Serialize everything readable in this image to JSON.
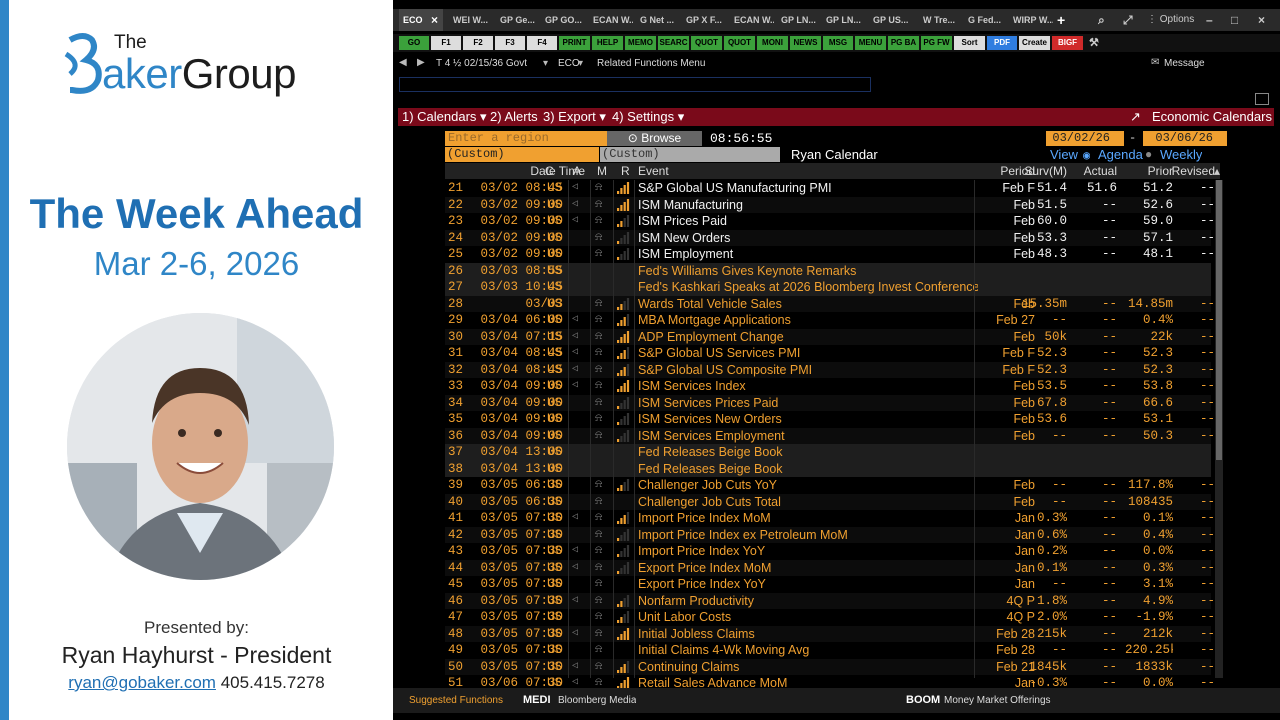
{
  "slide": {
    "logo_the": "The",
    "logo_brand_1": "aker",
    "logo_brand_2": "Group",
    "title": "The Week Ahead",
    "dates": "Mar 2-6, 2026",
    "presented_by": "Presented by:",
    "presenter": "Ryan Hayhurst - President",
    "email": "ryan@gobaker.com",
    "phone": "405.415.7278",
    "colors": {
      "brand_blue": "#2f86c7",
      "title_blue": "#1f6fb3"
    }
  },
  "terminal": {
    "tabs": [
      "ECO",
      "WEI W...",
      "GP Ge...",
      "GP GO...",
      "ECAN W...",
      "G Net ...",
      "GP X F...",
      "ECAN W...",
      "GP LN...",
      "GP LN...",
      "GP US...",
      "W Tre...",
      "G Fed...",
      "WIRP W..."
    ],
    "options_label": "Options",
    "fkeys": [
      "GO",
      "F1",
      "F2",
      "F3",
      "F4",
      "PRINT",
      "HELP",
      "MEMO",
      "SEARC",
      "QUOT",
      "QUOT",
      "MONI",
      "NEWS",
      "MSG",
      "MENU",
      "PG BA",
      "PG FW",
      "Sort",
      "PDF",
      "Create",
      "BIGF"
    ],
    "nav": {
      "security": "T 4 ½ 02/15/36 Govt",
      "function": "ECO",
      "related": "Related Functions Menu",
      "message": "Message"
    },
    "menu": {
      "calendars": "1) Calendars",
      "alerts": "2) Alerts",
      "export": "3) Export",
      "settings": "4) Settings",
      "title": "Economic Calendars"
    },
    "controls": {
      "region_placeholder": "Enter a region",
      "browse": "Browse",
      "time": "08:56:55",
      "date_from": "03/02/26",
      "date_to": "03/06/26",
      "custom1": "(Custom)",
      "custom2": "(Custom)",
      "calendar_name": "Ryan Calendar",
      "view_label": "View",
      "agenda": "Agenda",
      "weekly": "Weekly"
    },
    "columns": [
      "Date Time",
      "C",
      "A",
      "M",
      "R",
      "Event",
      "Period",
      "Surv(M)",
      "Actual",
      "Prior",
      "Revised"
    ],
    "rows": [
      {
        "n": "21",
        "dt": "03/02 08:45",
        "c": "US",
        "ev": "S&P Global US Manufacturing PMI",
        "per": "Feb F",
        "surv": "51.4",
        "act": "51.6",
        "prior": "51.2",
        "rev": "--",
        "style": "white",
        "bars": 4,
        "alert": true,
        "speaker": true
      },
      {
        "n": "22",
        "dt": "03/02 09:00",
        "c": "US",
        "ev": "ISM Manufacturing",
        "per": "Feb",
        "surv": "51.5",
        "act": "--",
        "prior": "52.6",
        "rev": "--",
        "style": "white",
        "bars": 4,
        "alert": true,
        "speaker": true
      },
      {
        "n": "23",
        "dt": "03/02 09:00",
        "c": "US",
        "ev": "ISM Prices Paid",
        "per": "Feb",
        "surv": "60.0",
        "act": "--",
        "prior": "59.0",
        "rev": "--",
        "style": "white",
        "bars": 2,
        "alert": true,
        "speaker": true
      },
      {
        "n": "24",
        "dt": "03/02 09:00",
        "c": "US",
        "ev": "ISM New Orders",
        "per": "Feb",
        "surv": "53.3",
        "act": "--",
        "prior": "57.1",
        "rev": "--",
        "style": "white",
        "bars": 1,
        "alert": true,
        "speaker": false
      },
      {
        "n": "25",
        "dt": "03/02 09:00",
        "c": "US",
        "ev": "ISM Employment",
        "per": "Feb",
        "surv": "48.3",
        "act": "--",
        "prior": "48.1",
        "rev": "--",
        "style": "white",
        "bars": 1,
        "alert": true,
        "speaker": false
      },
      {
        "n": "26",
        "dt": "03/03 08:55",
        "c": "US",
        "ev": "Fed's Williams Gives Keynote Remarks",
        "per": "",
        "surv": "",
        "act": "",
        "prior": "",
        "rev": "",
        "style": "event",
        "bars": 0,
        "alert": false,
        "speaker": false
      },
      {
        "n": "27",
        "dt": "03/03 10:45",
        "c": "US",
        "ev": "Fed's Kashkari Speaks at 2026 Bloomberg Invest Conference",
        "per": "",
        "surv": "",
        "act": "",
        "prior": "",
        "rev": "",
        "style": "event",
        "bars": 0,
        "alert": false,
        "speaker": false
      },
      {
        "n": "28",
        "dt": "03/03",
        "c": "US",
        "ev": "Wards Total Vehicle Sales",
        "per": "Feb",
        "surv": "15.35m",
        "act": "--",
        "prior": "14.85m",
        "rev": "--",
        "style": "orange",
        "bars": 2,
        "alert": true,
        "speaker": false
      },
      {
        "n": "29",
        "dt": "03/04 06:00",
        "c": "US",
        "ev": "MBA Mortgage Applications",
        "per": "Feb 27",
        "surv": "--",
        "act": "--",
        "prior": "0.4%",
        "rev": "--",
        "style": "orange",
        "bars": 3,
        "alert": true,
        "speaker": true
      },
      {
        "n": "30",
        "dt": "03/04 07:15",
        "c": "US",
        "ev": "ADP Employment Change",
        "per": "Feb",
        "surv": "50k",
        "act": "--",
        "prior": "22k",
        "rev": "--",
        "style": "orange",
        "bars": 4,
        "alert": true,
        "speaker": true
      },
      {
        "n": "31",
        "dt": "03/04 08:45",
        "c": "US",
        "ev": "S&P Global US Services PMI",
        "per": "Feb F",
        "surv": "52.3",
        "act": "--",
        "prior": "52.3",
        "rev": "--",
        "style": "orange",
        "bars": 3,
        "alert": true,
        "speaker": true
      },
      {
        "n": "32",
        "dt": "03/04 08:45",
        "c": "US",
        "ev": "S&P Global US Composite PMI",
        "per": "Feb F",
        "surv": "52.3",
        "act": "--",
        "prior": "52.3",
        "rev": "--",
        "style": "orange",
        "bars": 3,
        "alert": true,
        "speaker": true
      },
      {
        "n": "33",
        "dt": "03/04 09:00",
        "c": "US",
        "ev": "ISM Services Index",
        "per": "Feb",
        "surv": "53.5",
        "act": "--",
        "prior": "53.8",
        "rev": "--",
        "style": "orange",
        "bars": 4,
        "alert": true,
        "speaker": true
      },
      {
        "n": "34",
        "dt": "03/04 09:00",
        "c": "US",
        "ev": "ISM Services Prices Paid",
        "per": "Feb",
        "surv": "67.8",
        "act": "--",
        "prior": "66.6",
        "rev": "--",
        "style": "orange",
        "bars": 1,
        "alert": true,
        "speaker": false
      },
      {
        "n": "35",
        "dt": "03/04 09:00",
        "c": "US",
        "ev": "ISM Services New Orders",
        "per": "Feb",
        "surv": "53.6",
        "act": "--",
        "prior": "53.1",
        "rev": "--",
        "style": "orange",
        "bars": 1,
        "alert": true,
        "speaker": false
      },
      {
        "n": "36",
        "dt": "03/04 09:00",
        "c": "US",
        "ev": "ISM Services Employment",
        "per": "Feb",
        "surv": "--",
        "act": "--",
        "prior": "50.3",
        "rev": "--",
        "style": "orange",
        "bars": 1,
        "alert": true,
        "speaker": false
      },
      {
        "n": "37",
        "dt": "03/04 13:00",
        "c": "US",
        "ev": "Fed Releases Beige Book",
        "per": "",
        "surv": "",
        "act": "",
        "prior": "",
        "rev": "",
        "style": "event",
        "bars": 0,
        "alert": false,
        "speaker": false
      },
      {
        "n": "38",
        "dt": "03/04 13:00",
        "c": "US",
        "ev": "Fed Releases Beige Book",
        "per": "",
        "surv": "",
        "act": "",
        "prior": "",
        "rev": "",
        "style": "event",
        "bars": 0,
        "alert": false,
        "speaker": false
      },
      {
        "n": "39",
        "dt": "03/05 06:30",
        "c": "US",
        "ev": "Challenger Job Cuts YoY",
        "per": "Feb",
        "surv": "--",
        "act": "--",
        "prior": "117.8%",
        "rev": "--",
        "style": "orange",
        "bars": 2,
        "alert": true,
        "speaker": false
      },
      {
        "n": "40",
        "dt": "03/05 06:30",
        "c": "US",
        "ev": "Challenger Job Cuts Total",
        "per": "Feb",
        "surv": "--",
        "act": "--",
        "prior": "108435",
        "rev": "--",
        "style": "orange",
        "bars": 0,
        "alert": true,
        "speaker": false
      },
      {
        "n": "41",
        "dt": "03/05 07:30",
        "c": "US",
        "ev": "Import Price Index MoM",
        "per": "Jan",
        "surv": "0.3%",
        "act": "--",
        "prior": "0.1%",
        "rev": "--",
        "style": "orange",
        "bars": 3,
        "alert": true,
        "speaker": true
      },
      {
        "n": "42",
        "dt": "03/05 07:30",
        "c": "US",
        "ev": "Import Price Index ex Petroleum MoM",
        "per": "Jan",
        "surv": "0.6%",
        "act": "--",
        "prior": "0.4%",
        "rev": "--",
        "style": "orange",
        "bars": 1,
        "alert": true,
        "speaker": false
      },
      {
        "n": "43",
        "dt": "03/05 07:30",
        "c": "US",
        "ev": "Import Price Index YoY",
        "per": "Jan",
        "surv": "0.2%",
        "act": "--",
        "prior": "0.0%",
        "rev": "--",
        "style": "orange",
        "bars": 1,
        "alert": true,
        "speaker": true
      },
      {
        "n": "44",
        "dt": "03/05 07:30",
        "c": "US",
        "ev": "Export Price Index MoM",
        "per": "Jan",
        "surv": "0.1%",
        "act": "--",
        "prior": "0.3%",
        "rev": "--",
        "style": "orange",
        "bars": 1,
        "alert": true,
        "speaker": true
      },
      {
        "n": "45",
        "dt": "03/05 07:30",
        "c": "US",
        "ev": "Export Price Index YoY",
        "per": "Jan",
        "surv": "--",
        "act": "--",
        "prior": "3.1%",
        "rev": "--",
        "style": "orange",
        "bars": 0,
        "alert": true,
        "speaker": false
      },
      {
        "n": "46",
        "dt": "03/05 07:30",
        "c": "US",
        "ev": "Nonfarm Productivity",
        "per": "4Q P",
        "surv": "1.8%",
        "act": "--",
        "prior": "4.9%",
        "rev": "--",
        "style": "orange",
        "bars": 2,
        "alert": true,
        "speaker": true
      },
      {
        "n": "47",
        "dt": "03/05 07:30",
        "c": "US",
        "ev": "Unit Labor Costs",
        "per": "4Q P",
        "surv": "2.0%",
        "act": "--",
        "prior": "-1.9%",
        "rev": "--",
        "style": "orange",
        "bars": 2,
        "alert": true,
        "speaker": false
      },
      {
        "n": "48",
        "dt": "03/05 07:30",
        "c": "US",
        "ev": "Initial Jobless Claims",
        "per": "Feb 28",
        "surv": "215k",
        "act": "--",
        "prior": "212k",
        "rev": "--",
        "style": "orange",
        "bars": 4,
        "alert": true,
        "speaker": true
      },
      {
        "n": "49",
        "dt": "03/05 07:30",
        "c": "US",
        "ev": "Initial Claims 4-Wk Moving Avg",
        "per": "Feb 28",
        "surv": "--",
        "act": "--",
        "prior": "220.25k",
        "rev": "--",
        "style": "orange",
        "bars": 0,
        "alert": true,
        "speaker": false
      },
      {
        "n": "50",
        "dt": "03/05 07:30",
        "c": "US",
        "ev": "Continuing Claims",
        "per": "Feb 21",
        "surv": "1845k",
        "act": "--",
        "prior": "1833k",
        "rev": "--",
        "style": "orange",
        "bars": 3,
        "alert": true,
        "speaker": true
      },
      {
        "n": "51",
        "dt": "03/06 07:30",
        "c": "US",
        "ev": "Retail Sales Advance MoM",
        "per": "Jan",
        "surv": "-0.3%",
        "act": "--",
        "prior": "0.0%",
        "rev": "--",
        "style": "orange",
        "bars": 4,
        "alert": true,
        "speaker": true
      }
    ],
    "bottom": {
      "suggested": "Suggested Functions",
      "medi": "MEDI",
      "medi_desc": "Bloomberg Media",
      "boom": "BOOM",
      "boom_desc": "Money Market Offerings"
    }
  }
}
